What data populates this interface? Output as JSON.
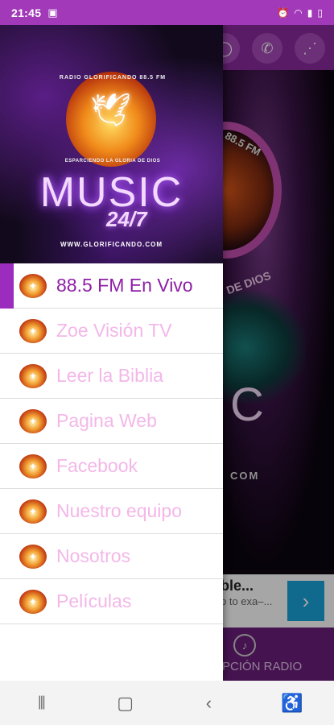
{
  "statusbar": {
    "time": "21:45",
    "photo_icon": "photo-icon",
    "right_icons": [
      "alarm-icon",
      "wifi-icon",
      "signal-icon",
      "battery-icon"
    ]
  },
  "drawer": {
    "header": {
      "arc_top": "RADIO GLORIFICANDO 88.5 FM",
      "arc_bottom": "ESPARCIENDO LA GLORIA DE DIOS",
      "title": "MUSIC",
      "subtitle": "24/7",
      "url": "WWW.GLORIFICANDO.COM"
    },
    "items": [
      {
        "label": "88.5 FM En Vivo",
        "active": true
      },
      {
        "label": "Zoe Visión TV"
      },
      {
        "label": "Leer la Biblia"
      },
      {
        "label": "Pagina Web"
      },
      {
        "label": "Facebook"
      },
      {
        "label": "Nuestro equipo"
      },
      {
        "label": "Nosotros"
      },
      {
        "label": "Películas"
      }
    ]
  },
  "background": {
    "fm_text": "88.5 FM",
    "dios_text": "DE DIOS",
    "big_letters": "C",
    "com_text": "COM",
    "ad": {
      "title": "ble...",
      "line": "p to exa–..."
    },
    "bottom_tab_label": "PCIÓN RADIO"
  },
  "colors": {
    "accent": "#9c2cbd",
    "statusbar": "#a239b8",
    "menu_text": "#f3b7e8",
    "menu_active_text": "#8e1fa6"
  }
}
